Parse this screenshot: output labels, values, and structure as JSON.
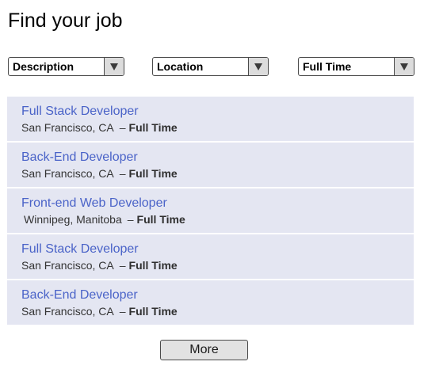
{
  "header": {
    "title": "Find your job"
  },
  "filters": {
    "description": {
      "selected": "Description"
    },
    "location": {
      "selected": "Location"
    },
    "job_type": {
      "selected": "Full Time"
    }
  },
  "jobs": [
    {
      "title": "Full Stack Developer",
      "location": "San Francisco, CA",
      "separator": "–",
      "type": "Full Time"
    },
    {
      "title": "Back-End Developer",
      "location": "San Francisco, CA",
      "separator": "–",
      "type": "Full Time"
    },
    {
      "title": "Front-end Web Developer",
      "location": "Winnipeg, Manitoba",
      "separator": "–",
      "type": "Full Time"
    },
    {
      "title": "Full Stack Developer",
      "location": "San Francisco, CA",
      "separator": "–",
      "type": "Full Time"
    },
    {
      "title": "Back-End Developer",
      "location": "San Francisco, CA",
      "separator": "–",
      "type": "Full Time"
    }
  ],
  "more_button": {
    "label": "More"
  },
  "colors": {
    "job_title": "#4a63c8",
    "job_background": "#e4e6f2",
    "select_arrow_background": "#dcdcdc",
    "button_background": "#e2e2e2"
  },
  "icons": {
    "select_arrow": "chevron-down-icon"
  }
}
